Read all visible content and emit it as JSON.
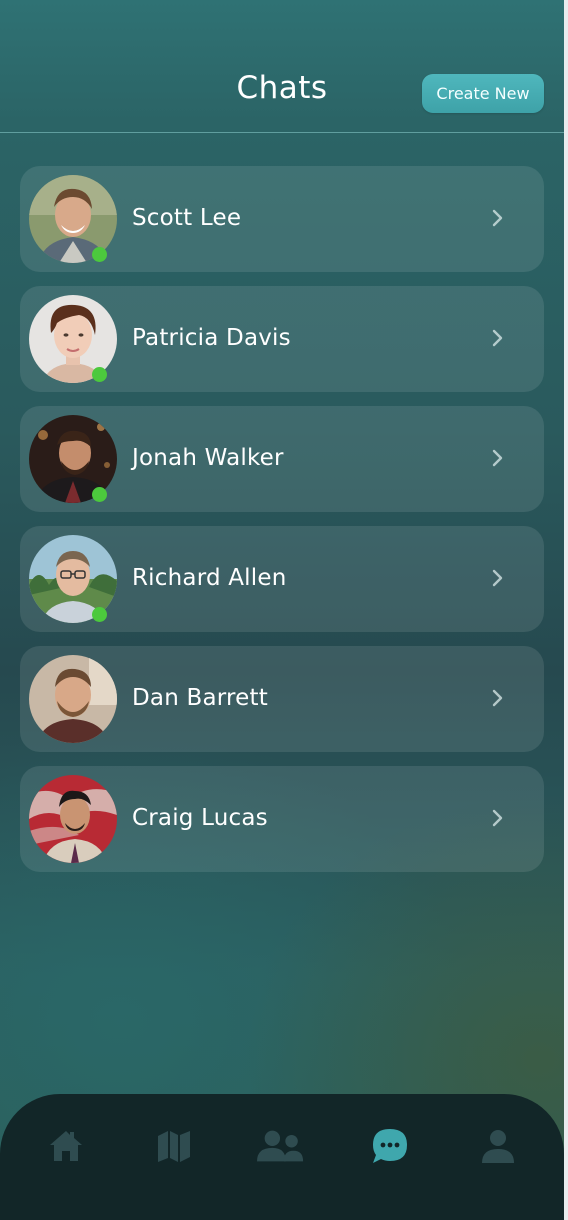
{
  "header": {
    "title": "Chats",
    "create_label": "Create New"
  },
  "chats": [
    {
      "name": "Scott Lee",
      "online": true
    },
    {
      "name": "Patricia Davis",
      "online": true
    },
    {
      "name": "Jonah Walker",
      "online": true
    },
    {
      "name": "Richard Allen",
      "online": true
    },
    {
      "name": "Dan Barrett",
      "online": false
    },
    {
      "name": "Craig Lucas",
      "online": false
    }
  ],
  "bottom_nav": {
    "items": [
      {
        "icon": "home-icon",
        "active": false
      },
      {
        "icon": "map-icon",
        "active": false
      },
      {
        "icon": "users-icon",
        "active": false
      },
      {
        "icon": "chat-bubble-icon",
        "active": true
      },
      {
        "icon": "profile-icon",
        "active": false
      }
    ]
  },
  "colors": {
    "accent": "#4fb7bd",
    "online": "#4cc93d",
    "nav_inactive": "#2f4c50",
    "nav_active": "#3fa7ad"
  }
}
